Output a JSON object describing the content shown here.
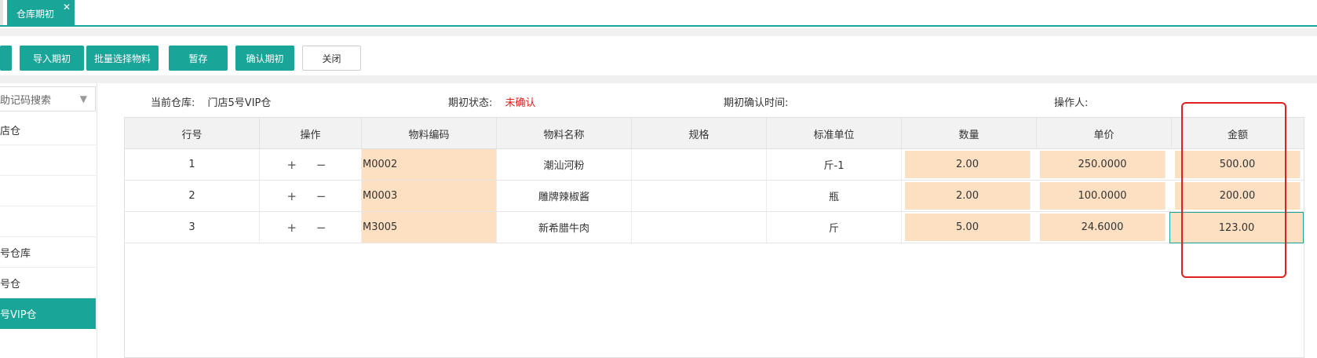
{
  "tabs": {
    "active_label": "仓库期初",
    "close_glyph": "✕"
  },
  "toolbar": {
    "import_label": "导入期初",
    "batch_select_label": "批量选择物料",
    "save_draft_label": "暂存",
    "confirm_label": "确认期初",
    "close_label": "关闭"
  },
  "sidebar": {
    "search_placeholder": "助记码搜索",
    "items": [
      {
        "label": "店仓"
      },
      {
        "label": ""
      },
      {
        "label": ""
      },
      {
        "label": ""
      },
      {
        "label": "号仓库"
      },
      {
        "label": "号仓"
      },
      {
        "label": "号VIP仓"
      }
    ],
    "active_index": 6
  },
  "info": {
    "warehouse_label": "当前仓库:",
    "warehouse_value": "门店5号VIP仓",
    "status_label": "期初状态:",
    "status_value": "未确认",
    "confirm_time_label": "期初确认时间:",
    "operator_label": "操作人:"
  },
  "table": {
    "columns": [
      "行号",
      "操作",
      "物料编码",
      "物料名称",
      "规格",
      "标准单位",
      "数量",
      "单价",
      "金额"
    ],
    "rows": [
      {
        "no": "1",
        "ops": "+ −",
        "code": "M0002",
        "name": "潮汕河粉",
        "spec": "",
        "unit": "斤-1",
        "qty": "2.00",
        "price": "250.0000",
        "amount": "500.00"
      },
      {
        "no": "2",
        "ops": "+ −",
        "code": "M0003",
        "name": "雕牌辣椒酱",
        "spec": "",
        "unit": "瓶",
        "qty": "2.00",
        "price": "100.0000",
        "amount": "200.00"
      },
      {
        "no": "3",
        "ops": "+ −",
        "code": "M3005",
        "name": "新希腊牛肉",
        "spec": "",
        "unit": "斤",
        "qty": "5.00",
        "price": "24.6000",
        "amount": "123.00"
      }
    ]
  },
  "colors": {
    "accent": "#1aa599",
    "editable_cell": "#fde0c2",
    "status_red": "#e02020",
    "highlight_red": "#e02020"
  }
}
